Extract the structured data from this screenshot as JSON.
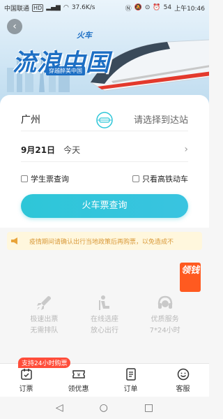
{
  "status_bar": {
    "carrier": "中国联通",
    "hd_label": "HD",
    "speed": "37.6K/s",
    "battery": "54",
    "time": "上午10:46"
  },
  "banner": {
    "title": "流浪中国",
    "tag": "火车",
    "subtitle": "穿越醉美中国"
  },
  "search": {
    "from_city": "广州",
    "to_station_placeholder": "请选择到达站",
    "date": "9月21日",
    "weekday": "今天",
    "student_label": "学生票查询",
    "highspeed_label": "只看高铁动车",
    "search_button": "火车票查询"
  },
  "notice": {
    "text": "疫情期间请确认出行当地政策后再购票，以免造成不"
  },
  "float_badge": {
    "text": "领钱"
  },
  "features": [
    {
      "icon": "rocket-icon",
      "line1": "极速出票",
      "line2": "无需排队"
    },
    {
      "icon": "seat-icon",
      "line1": "在线选座",
      "line2": "放心出行"
    },
    {
      "icon": "headset-icon",
      "line1": "优质服务",
      "line2": "7*24小时"
    }
  ],
  "promo_badge": "支持24小时购票",
  "tabs": [
    {
      "icon": "ticket-calendar-icon",
      "label": "订票"
    },
    {
      "icon": "coupon-icon",
      "label": "领优惠"
    },
    {
      "icon": "order-list-icon",
      "label": "订单"
    },
    {
      "icon": "service-smile-icon",
      "label": "客服"
    }
  ],
  "colors": {
    "accent": "#2ec6d8",
    "brand_blue": "#1d6fc4",
    "promo_red": "#ff4d3a",
    "notice_bg": "#fff7dd"
  }
}
